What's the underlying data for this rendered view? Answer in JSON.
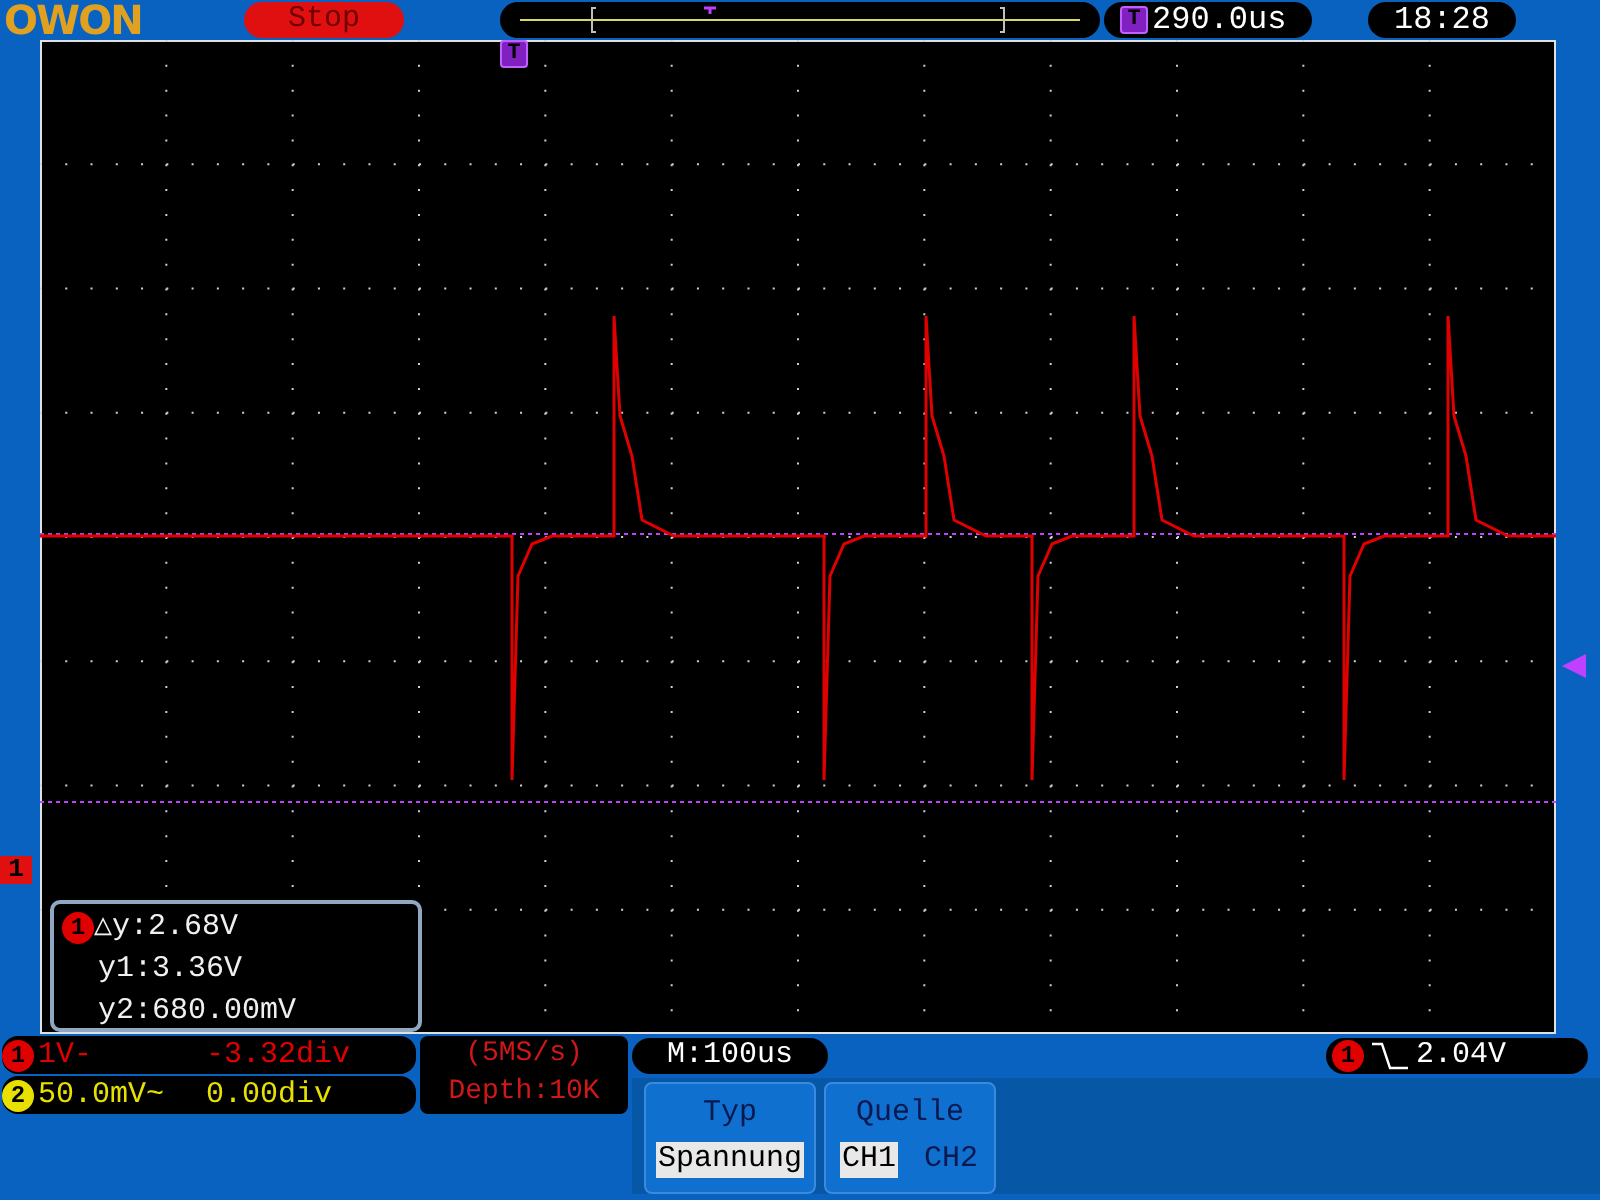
{
  "header": {
    "logo": "OWON",
    "run_state": "Stop",
    "trigger_position_marker": "T",
    "trigger_position": "290.0us",
    "clock": "18:28"
  },
  "screen": {
    "trigger_time_marker": "T",
    "ch1_marker": "1",
    "cursor_readout": {
      "channel": "1",
      "lines": [
        "△y:2.68V",
        "y1:3.36V",
        "y2:680.00mV"
      ]
    }
  },
  "channels": [
    {
      "number": "1",
      "scale": "1V-",
      "offset": "-3.32div",
      "color": "#e00000"
    },
    {
      "number": "2",
      "scale": "50.0mV~",
      "offset": "0.00div",
      "color": "#e8e000"
    }
  ],
  "acquisition": {
    "rate": "(5MS/s)",
    "depth": "Depth:10K"
  },
  "timebase": "M:100us",
  "trigger": {
    "channel": "1",
    "level": "2.04V"
  },
  "menu": [
    {
      "title": "Typ",
      "options": [
        {
          "label": "Spannung",
          "selected": true
        }
      ]
    },
    {
      "title": "Quelle",
      "options": [
        {
          "label": "CH1",
          "selected": true
        },
        {
          "label": "CH2",
          "selected": false
        }
      ]
    }
  ]
}
